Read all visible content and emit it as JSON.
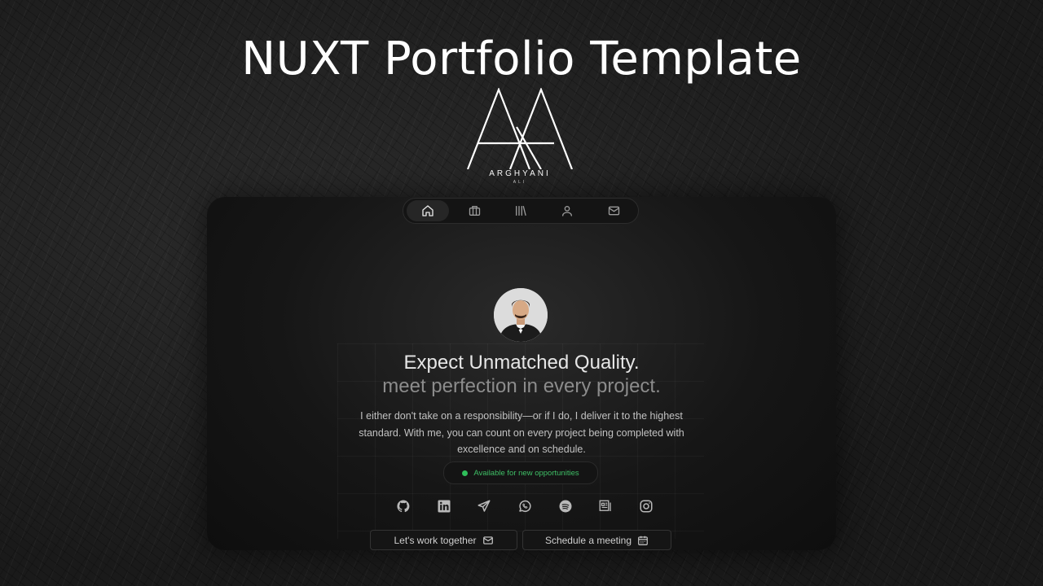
{
  "headline": "NUXT Portfolio Template",
  "logo": {
    "name": "ARGHYANI",
    "sub": "ALI"
  },
  "nav": [
    {
      "icon": "home-icon",
      "active": true
    },
    {
      "icon": "briefcase-icon",
      "active": false
    },
    {
      "icon": "library-icon",
      "active": false
    },
    {
      "icon": "user-icon",
      "active": false
    },
    {
      "icon": "mail-icon",
      "active": false
    }
  ],
  "hero": {
    "title_line1": "Expect Unmatched Quality.",
    "title_line2": "meet perfection in every project.",
    "description": "I either don't take on a responsibility—or if I do, I deliver it to the highest standard. With me, you can count on every project being completed with excellence and on schedule.",
    "status": "Available for new opportunities"
  },
  "socials": [
    "github-icon",
    "linkedin-icon",
    "telegram-icon",
    "whatsapp-icon",
    "spotify-icon",
    "blog-icon",
    "instagram-icon"
  ],
  "buttons": {
    "work_together": "Let's work together",
    "schedule": "Schedule a meeting"
  },
  "colors": {
    "status_green": "#2fbe5a",
    "panel_bg": "#161616"
  }
}
